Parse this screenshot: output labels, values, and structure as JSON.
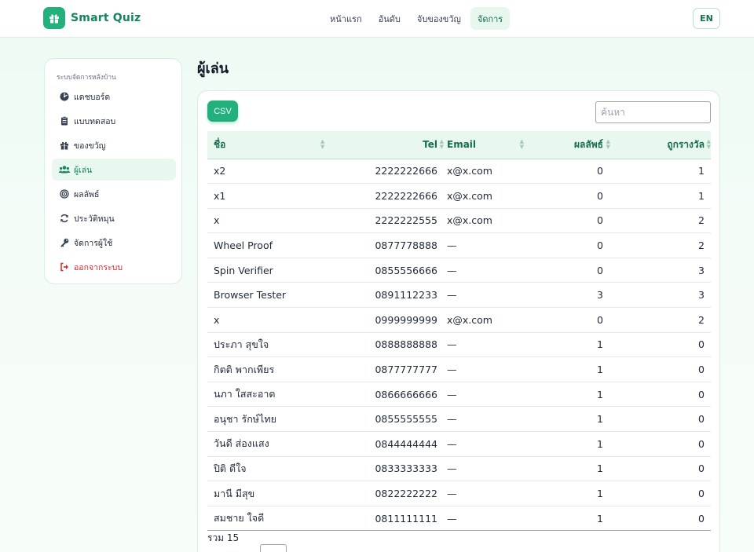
{
  "app": {
    "name": "Smart Quiz",
    "brand_color": "#22b07d"
  },
  "nav": {
    "items": [
      {
        "label": "หน้าแรก",
        "active": false
      },
      {
        "label": "อันดับ",
        "active": false
      },
      {
        "label": "จับของขวัญ",
        "active": false
      },
      {
        "label": "จัดการ",
        "active": true
      }
    ],
    "lang_label": "EN"
  },
  "sidebar": {
    "heading": "ระบบจัดการหลังบ้าน",
    "items": [
      {
        "label": "แดชบอร์ด",
        "icon": "dashboard-icon",
        "active": false
      },
      {
        "label": "แบบทดสอบ",
        "icon": "clipboard-icon",
        "active": false
      },
      {
        "label": "ของขวัญ",
        "icon": "gift-icon",
        "active": false
      },
      {
        "label": "ผู้เล่น",
        "icon": "users-icon",
        "active": true
      },
      {
        "label": "ผลลัพธ์",
        "icon": "target-icon",
        "active": false
      },
      {
        "label": "ประวัติหมุน",
        "icon": "refresh-icon",
        "active": false
      },
      {
        "label": "จัดการผู้ใช้",
        "icon": "key-icon",
        "active": false
      },
      {
        "label": "ออกจากระบบ",
        "icon": "logout-icon",
        "active": false
      }
    ]
  },
  "main": {
    "title": "ผู้เล่น",
    "csv_label": "CSV",
    "search_placeholder": "ค้นหา",
    "total_label": "รวม 15"
  },
  "table": {
    "columns": [
      "ชื่อ",
      "Tel",
      "Email",
      "ผลลัพธ์",
      "ถูกรางวัล"
    ],
    "rows": [
      [
        "x2",
        "2222222666",
        "x@x.com",
        "0",
        "1"
      ],
      [
        "x1",
        "2222222666",
        "x@x.com",
        "0",
        "1"
      ],
      [
        "x",
        "2222222555",
        "x@x.com",
        "0",
        "2"
      ],
      [
        "Wheel Proof",
        "0877778888",
        "—",
        "0",
        "2"
      ],
      [
        "Spin Verifier",
        "0855556666",
        "—",
        "0",
        "3"
      ],
      [
        "Browser Tester",
        "0891112233",
        "—",
        "3",
        "3"
      ],
      [
        "x",
        "0999999999",
        "x@x.com",
        "0",
        "2"
      ],
      [
        "ประภา สุขใจ",
        "0888888888",
        "—",
        "1",
        "0"
      ],
      [
        "กิตติ พากเพียร",
        "0877777777",
        "—",
        "1",
        "0"
      ],
      [
        "นภา ใสสะอาด",
        "0866666666",
        "—",
        "1",
        "0"
      ],
      [
        "อนุชา รักษ์ไทย",
        "0855555555",
        "—",
        "1",
        "0"
      ],
      [
        "วันดี ส่องแสง",
        "0844444444",
        "—",
        "1",
        "0"
      ],
      [
        "ปิติ ดีใจ",
        "0833333333",
        "—",
        "1",
        "0"
      ],
      [
        "มานี มีสุข",
        "0822222222",
        "—",
        "1",
        "0"
      ],
      [
        "สมชาย ใจดี",
        "0811111111",
        "—",
        "1",
        "0"
      ]
    ]
  }
}
